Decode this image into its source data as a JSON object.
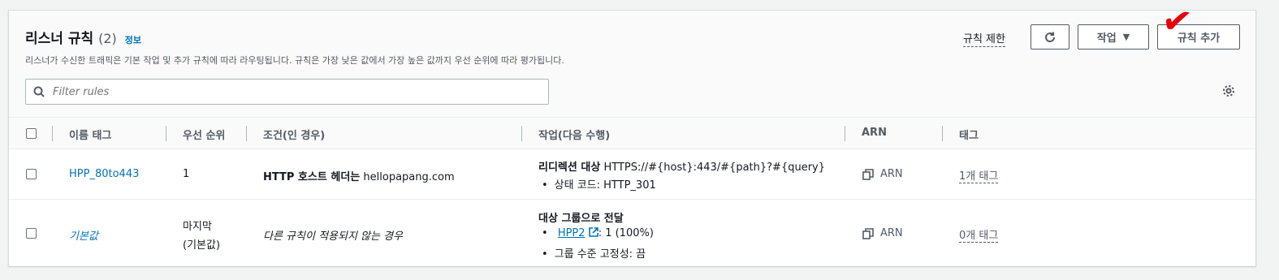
{
  "header": {
    "title": "리스너 규칙",
    "count": "(2)",
    "info": "정보",
    "description": "리스너가 수신한 트래픽은 기본 작업 및 추가 규칙에 따라 라우팅됩니다. 규칙은 가장 낮은 값에서 가장 높은 값까지 우선 순위에 따라 평가됩니다.",
    "limit_link": "규칙 제한",
    "action_button": "작업",
    "add_button": "규칙 추가"
  },
  "filter": {
    "placeholder": "Filter rules"
  },
  "columns": {
    "name": "이름 태그",
    "priority": "우선 순위",
    "condition": "조건(인 경우)",
    "action": "작업(다음 수행)",
    "arn": "ARN",
    "tags": "태그"
  },
  "rows": [
    {
      "name": "HPP_80to443",
      "priority": "1",
      "condition_bold": "HTTP 호스트 헤더는",
      "condition_value": "hellopapang.com",
      "action_title": "리디렉션 대상",
      "action_value": "HTTPS://#{host}:443/#{path}?#{query}",
      "action_bullet1": "상태 코드: HTTP_301",
      "arn": "ARN",
      "tags": "1개 태그"
    },
    {
      "name": "기본값",
      "priority_line1": "마지막",
      "priority_line2": "(기본값)",
      "condition": "다른 규칙이 적용되지 않는 경우",
      "action_title": "대상 그룹으로 전달",
      "target_group": "HPP2",
      "target_weight": ": 1 (100%)",
      "stickiness": "그룹 수준 고정성: 끔",
      "arn": "ARN",
      "tags": "0개 태그"
    }
  ],
  "icons": {
    "refresh": "refresh-icon",
    "search": "search-icon",
    "settings": "gear-icon",
    "copy": "copy-icon",
    "external": "external-link-icon",
    "annotation": "red-checkmark"
  },
  "colors": {
    "link": "#0073bb",
    "annotation": "#e8000b"
  }
}
